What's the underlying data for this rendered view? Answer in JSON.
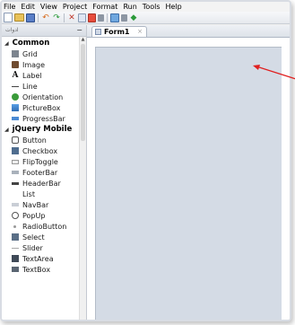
{
  "menu": [
    "File",
    "Edit",
    "View",
    "Project",
    "Format",
    "Run",
    "Tools",
    "Help"
  ],
  "toolbar": {
    "icons": [
      "new-file-icon",
      "open-folder-icon",
      "save-icon",
      "undo-icon",
      "redo-icon",
      "cut-icon",
      "copy-icon",
      "paste-icon",
      "find-icon",
      "image-icon",
      "run-icon"
    ]
  },
  "panel": {
    "header": "ادوات",
    "groups": [
      {
        "name": "Common",
        "items": [
          "Grid",
          "Image",
          "Label",
          "Line",
          "Orientation",
          "PictureBox",
          "ProgressBar"
        ]
      },
      {
        "name": "jQuery Mobile",
        "items": [
          "Button",
          "Checkbox",
          "FlipToggle",
          "FooterBar",
          "HeaderBar",
          "List",
          "NavBar",
          "PopUp",
          "RadioButton",
          "Select",
          "Slider",
          "TextArea",
          "TextBox"
        ]
      }
    ]
  },
  "tab": {
    "label": "Form1",
    "close": "×"
  },
  "colors": {
    "form_background": "#d4dbe5",
    "arrow": "#e02020"
  }
}
